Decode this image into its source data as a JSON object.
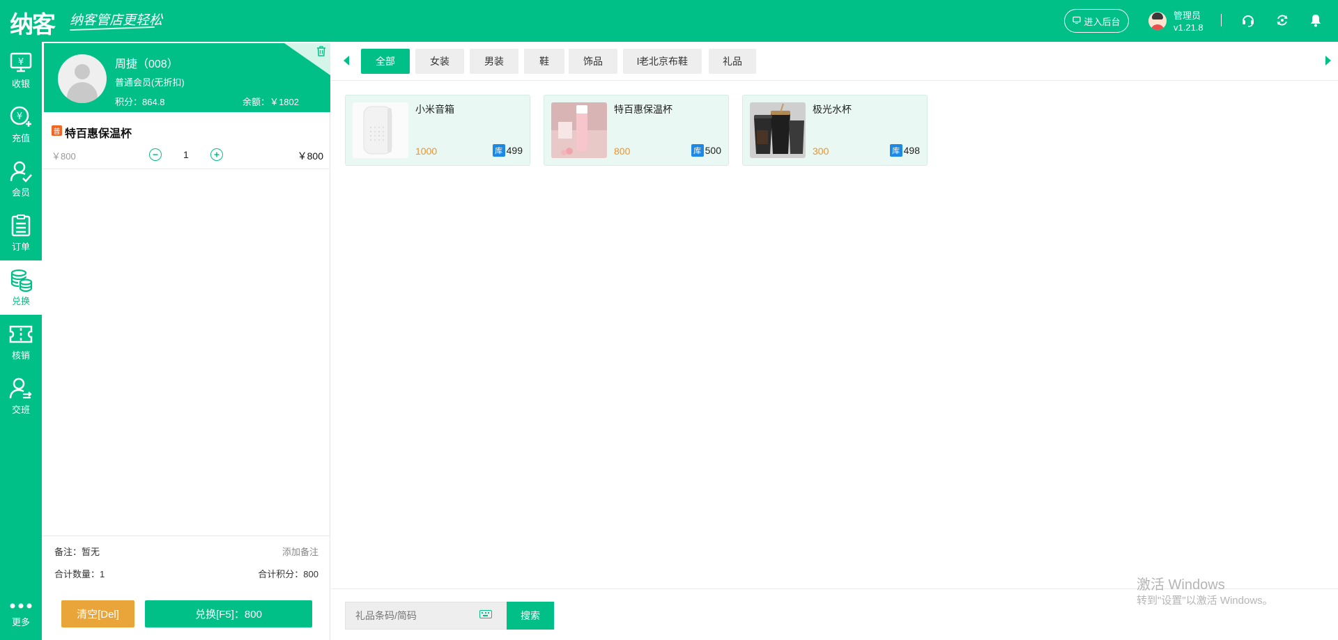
{
  "header": {
    "logo": "纳客",
    "slogan": "纳客管店更轻松",
    "backend_button": "进入后台",
    "admin_name": "管理员",
    "version": "v1.21.8",
    "brand_color": "#00c087"
  },
  "sidenav": {
    "items": [
      {
        "label": "收银",
        "icon": "cashier-icon"
      },
      {
        "label": "充值",
        "icon": "recharge-icon"
      },
      {
        "label": "会员",
        "icon": "member-icon"
      },
      {
        "label": "订单",
        "icon": "order-icon"
      },
      {
        "label": "兑换",
        "icon": "exchange-icon",
        "active": true
      },
      {
        "label": "核销",
        "icon": "ticket-icon"
      },
      {
        "label": "交班",
        "icon": "handover-icon"
      }
    ],
    "more_label": "更多"
  },
  "member": {
    "name": "周捷（008）",
    "level": "普通会员(无折扣)",
    "points": "积分：864.8",
    "balance": "余额：￥1802"
  },
  "cart": {
    "items": [
      {
        "tag": "普",
        "name": "特百惠保温杯",
        "orig_price": "￥800",
        "qty": "1",
        "total": "￥800"
      }
    ]
  },
  "summary": {
    "note": "备注：暂无",
    "add_note": "添加备注",
    "total_qty": "合计数量：1",
    "total_points": "合计积分：800"
  },
  "actions": {
    "clear": "清空[Del]",
    "exchange": "兑换[F5]：800"
  },
  "tabs": [
    {
      "label": "全部",
      "active": true
    },
    {
      "label": "女装"
    },
    {
      "label": "男装"
    },
    {
      "label": "鞋"
    },
    {
      "label": "饰品"
    },
    {
      "label": "l老北京布鞋"
    },
    {
      "label": "礼品"
    }
  ],
  "products": [
    {
      "name": "小米音箱",
      "price": "1000",
      "stock_tag": "库",
      "stock": "499"
    },
    {
      "name": "特百惠保温杯",
      "price": "800",
      "stock_tag": "库",
      "stock": "500"
    },
    {
      "name": "极光水杯",
      "price": "300",
      "stock_tag": "库",
      "stock": "498"
    }
  ],
  "search": {
    "placeholder": "礼品条码/简码",
    "button": "搜索"
  },
  "watermark": {
    "line1": "激活 Windows",
    "line2": "转到\"设置\"以激活 Windows。"
  }
}
